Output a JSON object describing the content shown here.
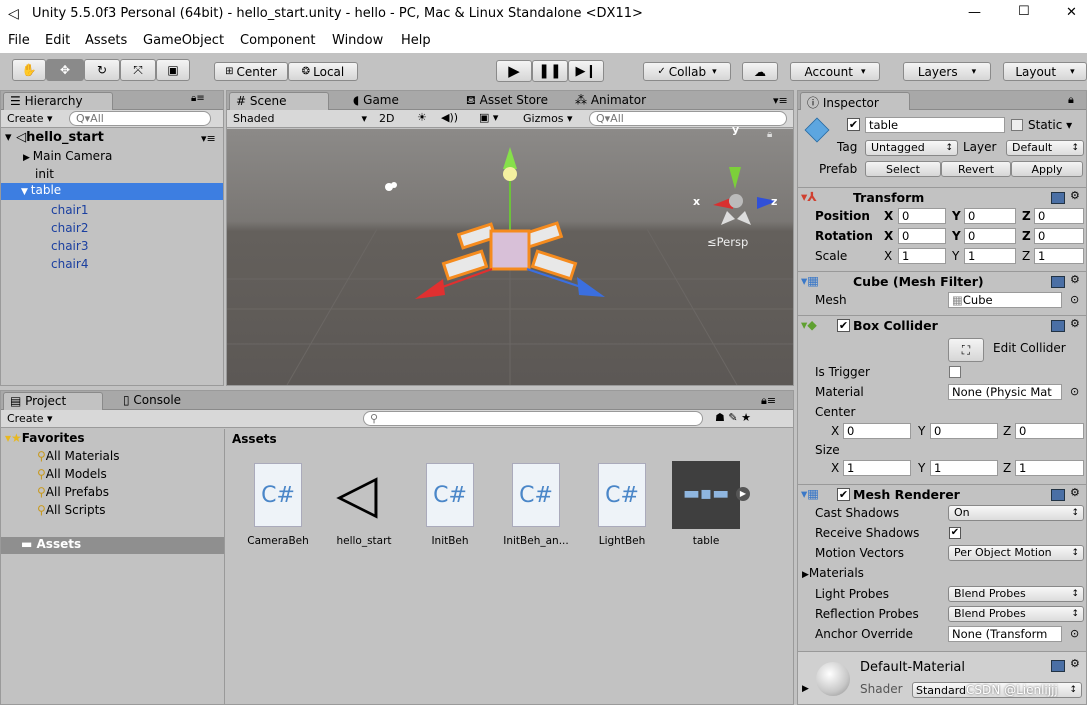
{
  "window": {
    "title": "Unity 5.5.0f3 Personal (64bit) - hello_start.unity - hello - PC, Mac & Linux Standalone <DX11>",
    "min": "—",
    "max": "☐",
    "close": "✕"
  },
  "menu": [
    "File",
    "Edit",
    "Assets",
    "GameObject",
    "Component",
    "Window",
    "Help"
  ],
  "toolbar": {
    "center": "Center",
    "local": "Local",
    "collab": "Collab",
    "account": "Account",
    "layers": "Layers",
    "layout": "Layout"
  },
  "hierarchy": {
    "tab": "Hierarchy",
    "create": "Create",
    "search": "Q▾All",
    "scene": "hello_start",
    "items": [
      "Main Camera",
      "init",
      "table",
      "chair1",
      "chair2",
      "chair3",
      "chair4"
    ]
  },
  "scene_view": {
    "tabs": [
      "Scene",
      "Game",
      "Asset Store",
      "Animator"
    ],
    "shading": "Shaded",
    "mode2d": "2D",
    "gizmos": "Gizmos",
    "search": "Q▾All",
    "persp": "Persp",
    "axis_y": "y",
    "axis_x": "x",
    "axis_z": "z"
  },
  "project": {
    "tabs": [
      "Project",
      "Console"
    ],
    "create": "Create",
    "favorites": "Favorites",
    "fav_items": [
      "All Materials",
      "All Models",
      "All Prefabs",
      "All Scripts"
    ],
    "assets_folder": "Assets",
    "assets_header": "Assets",
    "assets": [
      {
        "name": "CameraBeh",
        "icon": "csharp-icon"
      },
      {
        "name": "hello_start",
        "icon": "unity-icon"
      },
      {
        "name": "InitBeh",
        "icon": "csharp-icon"
      },
      {
        "name": "InitBeh_an...",
        "icon": "csharp-icon"
      },
      {
        "name": "LightBeh",
        "icon": "csharp-icon"
      },
      {
        "name": "table",
        "icon": "prefab-icon"
      }
    ]
  },
  "inspector": {
    "tab": "Inspector",
    "name": "table",
    "static": "Static",
    "tag_label": "Tag",
    "tag": "Untagged",
    "layer_label": "Layer",
    "layer": "Default",
    "prefab_label": "Prefab",
    "select": "Select",
    "revert": "Revert",
    "apply": "Apply",
    "transform": {
      "title": "Transform",
      "position": "Position",
      "rotation": "Rotation",
      "scale": "Scale",
      "pos": [
        "0",
        "0",
        "0"
      ],
      "rot": [
        "0",
        "0",
        "0"
      ],
      "scl": [
        "1",
        "1",
        "1"
      ]
    },
    "mesh_filter": {
      "title": "Cube (Mesh Filter)",
      "mesh_label": "Mesh",
      "mesh": "Cube"
    },
    "box_collider": {
      "title": "Box Collider",
      "edit": "Edit Collider",
      "is_trigger": "Is Trigger",
      "material_label": "Material",
      "material": "None (Physic Mat",
      "center": "Center",
      "size": "Size",
      "center_vals": [
        "0",
        "0",
        "0"
      ],
      "size_vals": [
        "1",
        "1",
        "1"
      ]
    },
    "mesh_renderer": {
      "title": "Mesh Renderer",
      "cast_shadows": "Cast Shadows",
      "cast_val": "On",
      "receive_shadows": "Receive Shadows",
      "motion_vectors": "Motion Vectors",
      "motion_val": "Per Object Motion",
      "materials": "Materials",
      "light_probes": "Light Probes",
      "light_val": "Blend Probes",
      "reflection_probes": "Reflection Probes",
      "reflection_val": "Blend Probes",
      "anchor_override": "Anchor Override",
      "anchor_val": "None (Transform"
    },
    "material": {
      "name": "Default-Material",
      "shader_label": "Shader",
      "shader": "Standard",
      "watermark": "CSDN @Lienlijjj"
    }
  }
}
